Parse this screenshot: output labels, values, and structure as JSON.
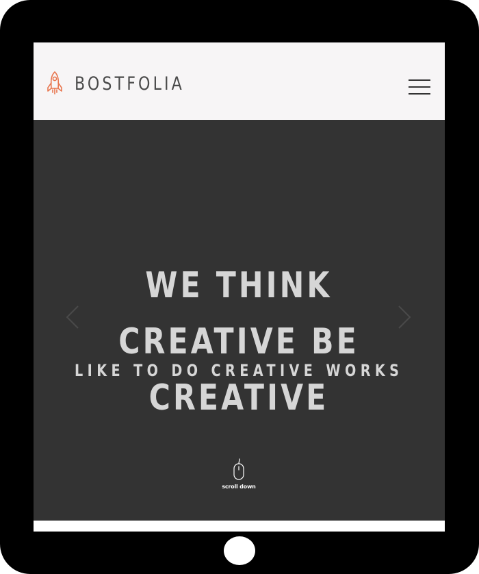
{
  "device": {
    "type": "tablet",
    "frame_color": "#000000"
  },
  "header": {
    "logo_icon": "rocket-icon",
    "logo_text": "BOSTFOLIA",
    "menu_icon": "hamburger-menu-icon",
    "background": "#f7f5f6",
    "accent_color": "#e8764f"
  },
  "hero": {
    "title": "WE THINK CREATIVE BE CREATIVE",
    "subtitle": "LIKE TO DO CREATIVE WORKS",
    "background": "#333333",
    "text_color": "#d6d6d6",
    "prev_icon": "chevron-left-icon",
    "next_icon": "chevron-right-icon",
    "scroll_icon": "mouse-icon",
    "scroll_label": "scroll down"
  }
}
